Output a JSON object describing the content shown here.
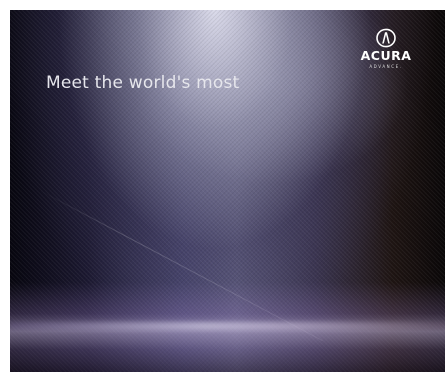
{
  "ad": {
    "headline": "Meet the world's most",
    "brand": {
      "name": "ACURA",
      "tagline": "ADVANCE.",
      "icon": "acura-caliper-icon"
    },
    "colors": {
      "text": "#e6e6ec",
      "logo": "#ffffff"
    }
  }
}
